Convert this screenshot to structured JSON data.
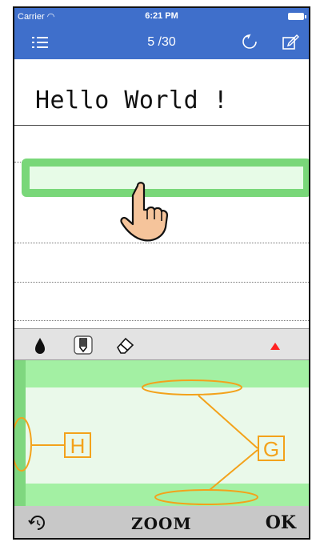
{
  "status_bar": {
    "carrier": "Carrier",
    "time": "6:21 PM"
  },
  "nav": {
    "title": "5 /30",
    "left_icon": "menu-icon",
    "right_icons": [
      "refresh-icon",
      "compose-icon"
    ]
  },
  "editor": {
    "text": "Hello World !"
  },
  "toolbar": {
    "tools": [
      "ink-drop-icon",
      "pen-icon",
      "eraser-icon",
      "collapse-triangle-icon"
    ],
    "accent_red": "#ff2222"
  },
  "preview": {
    "label_h": "H",
    "label_g": "G"
  },
  "bottom_bar": {
    "rotate_icon": "rotate-icon",
    "zoom_label": "ZOOM",
    "ok_label": "OK"
  },
  "colors": {
    "nav_blue": "#3f6fcb",
    "highlight_green": "#79d779",
    "annotation_orange": "#f3a21b"
  }
}
